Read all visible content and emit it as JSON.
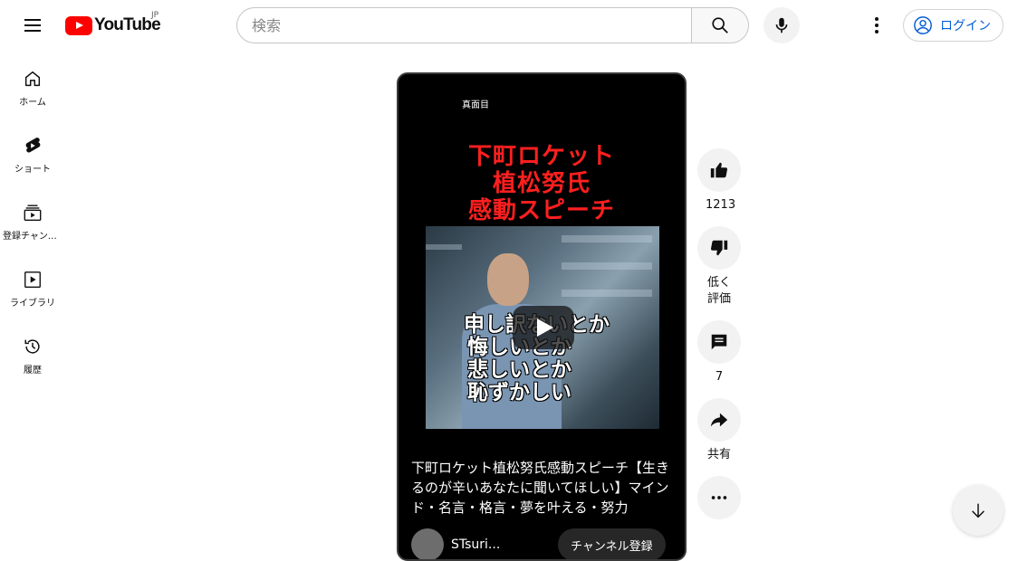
{
  "header": {
    "logo_text": "YouTube",
    "country_code": "JP",
    "search_placeholder": "検索",
    "login_label": "ログイン"
  },
  "sidebar": {
    "items": [
      {
        "label": "ホーム",
        "icon": "home-icon"
      },
      {
        "label": "ショート",
        "icon": "shorts-icon"
      },
      {
        "label": "登録チャンネル",
        "icon": "subscriptions-icon"
      },
      {
        "label": "ライブラリ",
        "icon": "library-icon"
      },
      {
        "label": "履歴",
        "icon": "history-icon"
      }
    ]
  },
  "short": {
    "channel_tag": "真面目",
    "thumbnail_title_lines": [
      "下町ロケット",
      "植松努氏",
      "感動スピーチ"
    ],
    "thumbnail_overlay_lines": [
      "申し訳ないとか",
      "悔しいとか",
      "悲しいとか",
      "恥ずかしい"
    ],
    "video_title": "下町ロケット植松努氏感動スピーチ【生きるのが辛いあなたに聞いてほしい】マインド・名言・格言・夢を叶える・努力",
    "channel_name": "STsuri...",
    "subscribe_label": "チャンネル登録"
  },
  "actions": {
    "like_count": "1213",
    "dislike_label": "低く評価",
    "comment_count": "7",
    "share_label": "共有"
  },
  "colors": {
    "brand_red": "#ff0000",
    "link_blue": "#065fd4",
    "thumbnail_title_red": "#ff1f1f"
  }
}
